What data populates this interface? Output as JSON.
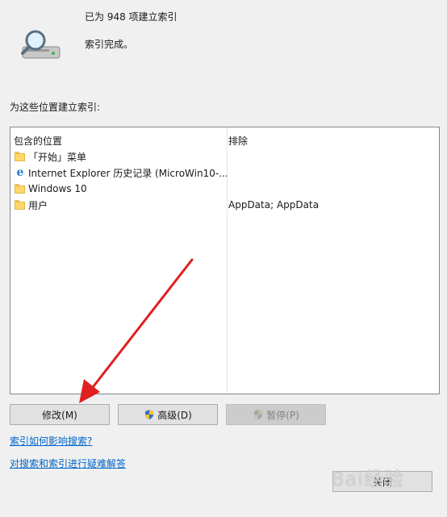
{
  "status": {
    "count_text": "已为 948 项建立索引",
    "complete_text": "索引完成。"
  },
  "locations_label": "为这些位置建立索引:",
  "table": {
    "header_location": "包含的位置",
    "header_exclude": "排除",
    "rows": [
      {
        "icon": "folder-icon",
        "name": "「开始」菜单",
        "exclude": ""
      },
      {
        "icon": "internet-explorer-icon",
        "name": "Internet Explorer 历史记录 (MicroWin10-...",
        "exclude": ""
      },
      {
        "icon": "folder-icon",
        "name": "Windows 10",
        "exclude": ""
      },
      {
        "icon": "folder-icon",
        "name": "用户",
        "exclude": "AppData; AppData"
      }
    ]
  },
  "buttons": {
    "modify": "修改(M)",
    "advanced": "高级(D)",
    "pause": "暂停(P)",
    "close": "关闭"
  },
  "links": {
    "how_affects": "索引如何影响搜索?",
    "troubleshoot": "对搜索和索引进行疑难解答"
  },
  "annotation": {
    "arrow_color": "#e02020"
  },
  "watermark": "Bai经验"
}
